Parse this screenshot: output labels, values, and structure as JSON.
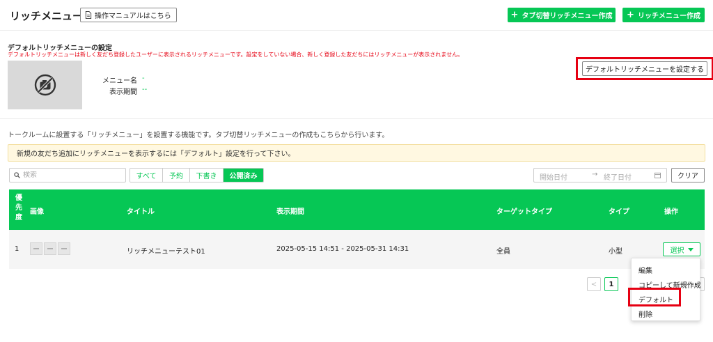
{
  "header": {
    "title": "リッチメニュー",
    "manual_label": "操作マニュアルはこちら",
    "create_tab_rich_menu_label": "タブ切替リッチメニュー作成",
    "create_rich_menu_label": "リッチメニュー作成"
  },
  "default_section": {
    "title": "デフォルトリッチメニューの設定",
    "description": "デフォルトリッチメニューは新しく友だち登録したユーザーに表示されるリッチメニューです。設定をしていない場合、新しく登録した友だちにはリッチメニューが表示されません。",
    "menu_name_label": "メニュー名",
    "menu_name_value": "-",
    "period_label": "表示期間",
    "period_value": "--",
    "set_default_button": "デフォルトリッチメニューを設定する"
  },
  "intro": "トークルームに設置する「リッチメニュー」を設置する機能です。タブ切替リッチメニューの作成もこちらから行います。",
  "notice": "新規の友だち追加にリッチメニューを表示するには「デフォルト」設定を行って下さい。",
  "search": {
    "placeholder": "検索"
  },
  "filters": [
    "すべて",
    "予約",
    "下書き",
    "公開済み"
  ],
  "active_filter": "公開済み",
  "date_range": {
    "start_placeholder": "開始日付",
    "end_placeholder": "終了日付",
    "separator": "→"
  },
  "clear_label": "クリア",
  "table": {
    "headers": {
      "priority": "優先度",
      "image": "画像",
      "title": "タイトル",
      "period": "表示期間",
      "target": "ターゲットタイプ",
      "type": "タイプ",
      "action": "操作"
    },
    "priority_chars": [
      "優",
      "先",
      "度"
    ],
    "rows": [
      {
        "priority": "1",
        "title": "リッチメニューテスト01",
        "period": "2025-05-15 14:51  -  2025-05-31 14:31",
        "target": "全員",
        "type": "小型",
        "action_label": "選択"
      }
    ]
  },
  "dropdown": [
    "編集",
    "コピーして新規作成",
    "デフォルト",
    "削除"
  ],
  "pagination": {
    "prev": "<",
    "current": "1",
    "next": ">"
  },
  "colors": {
    "brand_green": "#06c755",
    "highlight_red": "#e60012",
    "notice_bg": "#fff8e1"
  },
  "icons": {
    "manual": "document-icon",
    "plus": "plus-icon",
    "no_image": "no-photo-icon",
    "search": "search-icon",
    "calendar": "calendar-icon",
    "caret": "caret-down-icon"
  }
}
